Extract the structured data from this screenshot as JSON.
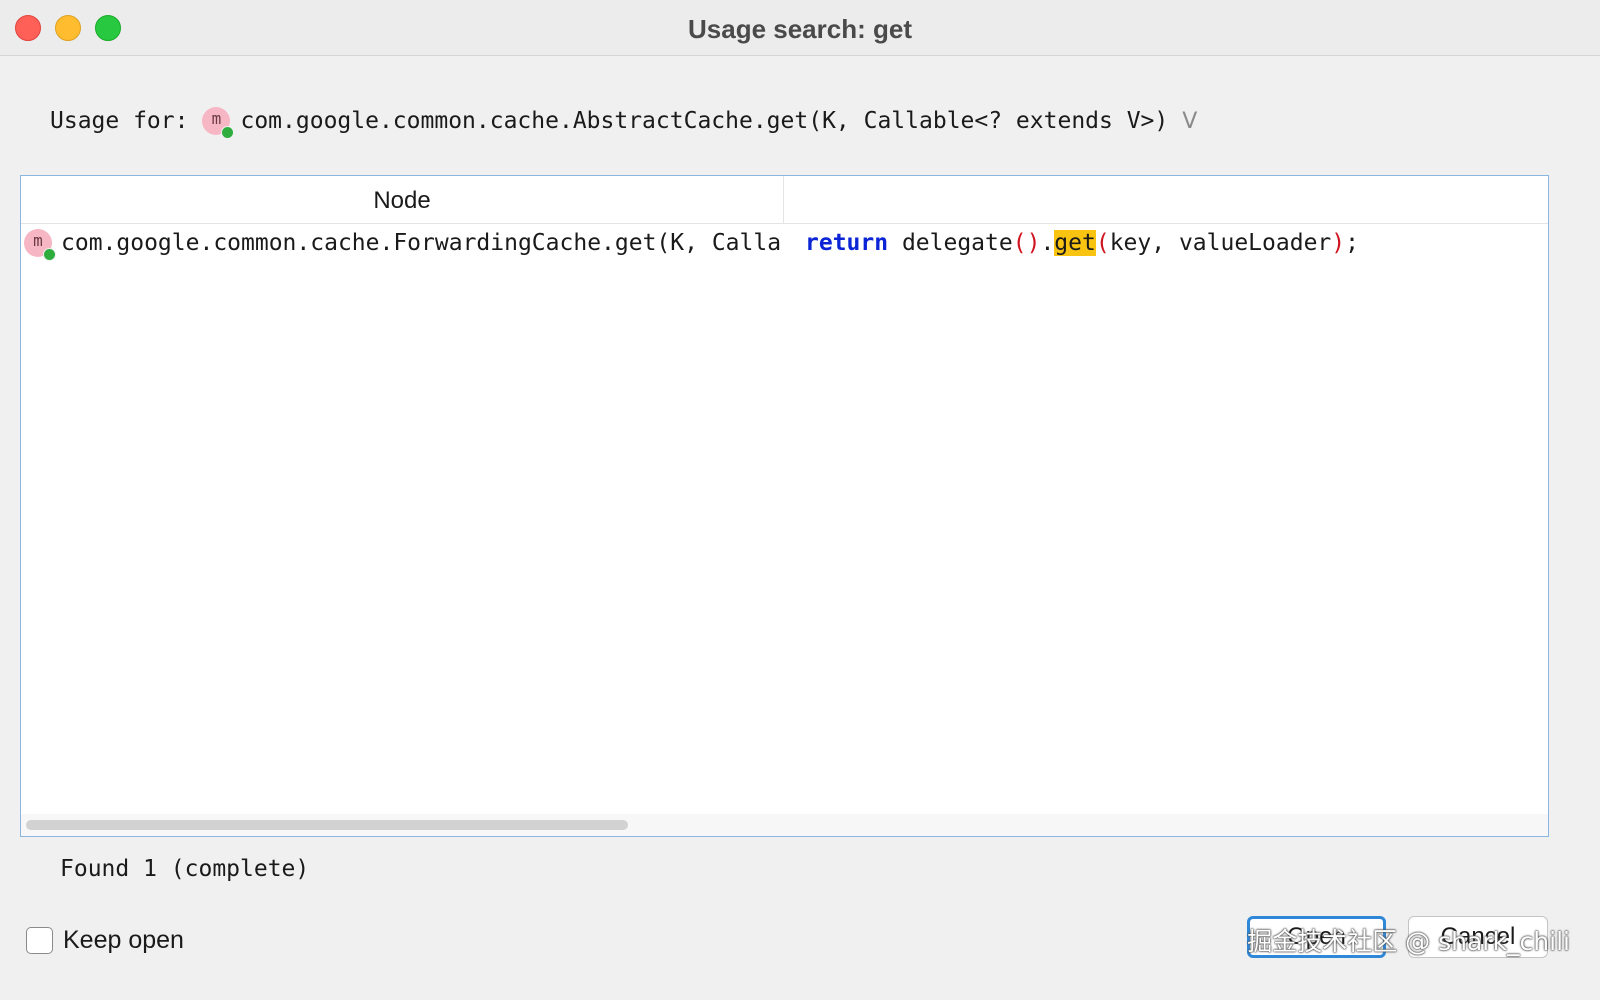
{
  "window": {
    "title": "Usage search: get"
  },
  "usage": {
    "label": "Usage for:",
    "icon": "method-icon",
    "icon_letter": "m",
    "signature": "com.google.common.cache.AbstractCache.get(K, Callable<? extends V>)",
    "expand_glyph": "V"
  },
  "table": {
    "columns": [
      "Node",
      ""
    ],
    "rows": [
      {
        "icon": "method-icon",
        "icon_letter": "m",
        "node": "com.google.common.cache.ForwardingCache.get(K, Callable<? extends V>)",
        "code": {
          "keyword": "return",
          "before": " delegate",
          "paren_open": "(",
          "paren_close": ")",
          "dot": ".",
          "match": "get",
          "args_open": "(",
          "args": "key, valueLoader",
          "args_close": ")",
          "end": ";"
        }
      }
    ]
  },
  "status": {
    "found": "Found 1 (complete)"
  },
  "footer": {
    "keep_open_label": "Keep open",
    "keep_open_checked": false,
    "open_button": "Open",
    "cancel_button": "Cancel",
    "watermark": "掘金技术社区 @ shark_chili"
  },
  "colors": {
    "keyword": "#0a24d6",
    "paren": "#d0131f",
    "match_highlight": "#f9c411",
    "focus_ring": "#2f87d8"
  }
}
